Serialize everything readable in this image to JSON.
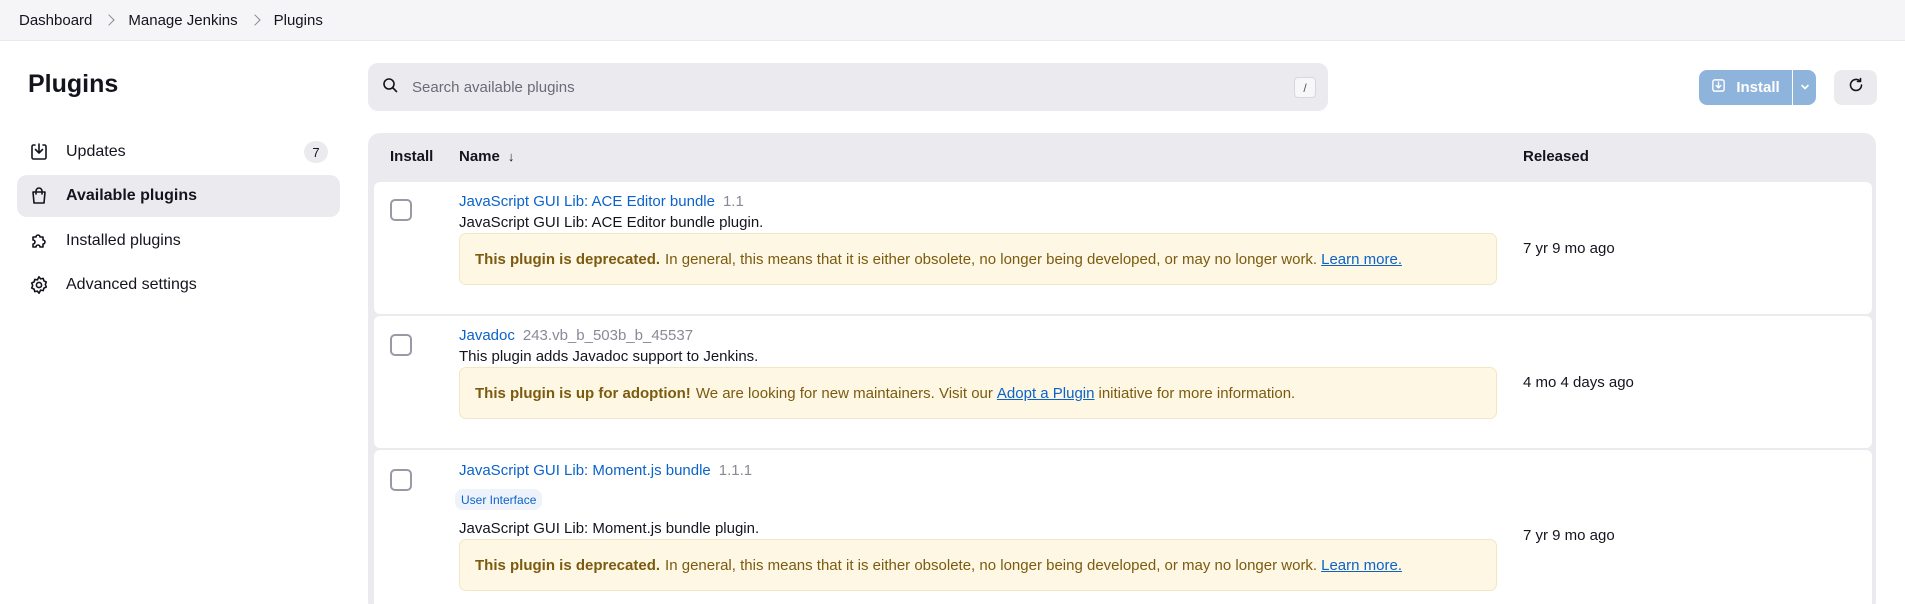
{
  "breadcrumb": [
    "Dashboard",
    "Manage Jenkins",
    "Plugins"
  ],
  "sidebar": {
    "title": "Plugins",
    "items": [
      {
        "label": "Updates",
        "badge": "7",
        "icon": "download-icon"
      },
      {
        "label": "Available plugins",
        "icon": "shopping-bag-icon",
        "active": true
      },
      {
        "label": "Installed plugins",
        "icon": "puzzle-icon"
      },
      {
        "label": "Advanced settings",
        "icon": "gear-icon"
      }
    ]
  },
  "search": {
    "placeholder": "Search available plugins",
    "shortcut": "/"
  },
  "toolbar": {
    "install_label": "Install"
  },
  "table": {
    "headers": {
      "install": "Install",
      "name": "Name",
      "released": "Released"
    },
    "rows": [
      {
        "name": "JavaScript GUI Lib: ACE Editor bundle",
        "version": "1.1",
        "description": "JavaScript GUI Lib: ACE Editor bundle plugin.",
        "notice_bold": "This plugin is deprecated.",
        "notice_text": "In general, this means that it is either obsolete, no longer being developed, or may no longer work.",
        "notice_link": "Learn more.",
        "released": "7 yr 9 mo ago"
      },
      {
        "name": "Javadoc",
        "version": "243.vb_b_503b_b_45537",
        "description": "This plugin adds Javadoc support to Jenkins.",
        "notice_bold": "This plugin is up for adoption!",
        "notice_text": "We are looking for new maintainers. Visit our",
        "notice_link": "Adopt a Plugin",
        "notice_tail": "initiative for more information.",
        "released": "4 mo 4 days ago"
      },
      {
        "name": "JavaScript GUI Lib: Moment.js bundle",
        "version": "1.1.1",
        "tag": "User Interface",
        "description": "JavaScript GUI Lib: Moment.js bundle plugin.",
        "notice_bold": "This plugin is deprecated.",
        "notice_text": "In general, this means that it is either obsolete, no longer being developed, or may no longer work.",
        "notice_link": "Learn more.",
        "released": "7 yr 9 mo ago"
      }
    ]
  }
}
